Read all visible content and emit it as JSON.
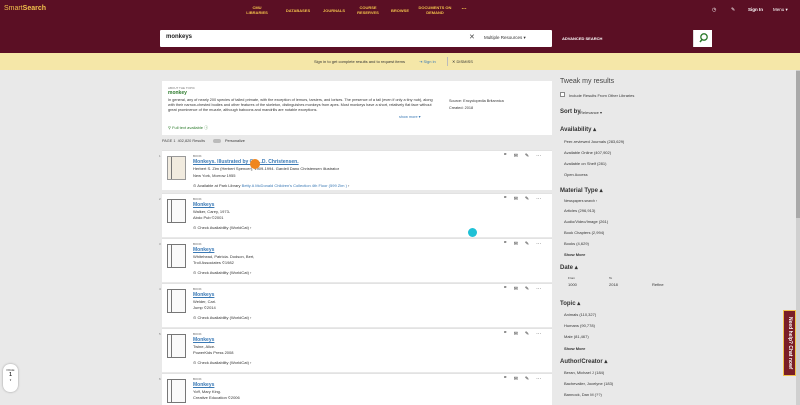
{
  "header": {
    "logo_prefix": "Smart",
    "logo_suffix": "Search",
    "nav": [
      "CMU LIBRARIES",
      "DATABASES",
      "JOURNALS",
      "COURSE RESERVES",
      "BROWSE",
      "DOCUMENTS ON DEMAND",
      "..."
    ],
    "sign_in": "Sign In",
    "menu": "Menu"
  },
  "search": {
    "value": "monkeys",
    "scope": "Multiple Resources",
    "advanced": "ADVANCED SEARCH"
  },
  "signin_banner": {
    "text": "Sign in to get complete results and to request items",
    "link": "Sign in",
    "dismiss": "DISMISS"
  },
  "topic": {
    "label": "ABOUT THE TOPIC",
    "name": "monkey",
    "text": "In general, any of nearly 200 species of tailed primate, with the exception of lemurs, tarsiers, and lorises. The presence of a tail (even if only a tiny nub), along with their narrow-chested bodies and other features of the skeleton, distinguishes monkeys from apes. Most monkeys have a short, relatively flat face without great prominence of the muzzle, although baboons and mandrills are notable exceptions.",
    "more": "show more",
    "source_label": "Source:",
    "source": "Encyclopedia Britannica",
    "created_label": "Created:",
    "created": "2018",
    "fulltext": "Full text available"
  },
  "results_meta": {
    "page_label": "PAGE 1",
    "count": "402,820 Results",
    "personalize": "Personalize"
  },
  "results": [
    {
      "type": "BOOK",
      "title": "Monkeys. Illustrated by G...",
      "title2": "...D. Christensen.",
      "line1": "Herbert S. Zim (Herbert Spencer), 1909-1994. Gardell Dano Christensen illustrator",
      "line2": "New York, Morrow 1955",
      "avail": "Available at Park Library",
      "avail_detail": "Betty A McDonald Children's Collection 4th Floor (599 Zim )",
      "num": "1"
    },
    {
      "type": "BOOK",
      "title": "Monkeys",
      "line1": "Walker, Carey, 1973-",
      "line2": "Abdo Pub ©2001",
      "avail": "Check Availability (WorldCat)",
      "num": "2"
    },
    {
      "type": "BOOK",
      "title": "Monkeys",
      "line1": "Whitehead, Patricia. Dodson, Bert,",
      "line2": "Troll Associates ©1982",
      "avail": "Check Availability (WorldCat)",
      "num": "3"
    },
    {
      "type": "BOOK",
      "title": "Monkeys",
      "line1": "Welder, Cari.",
      "line2": "Jump ©2014",
      "avail": "Check Availability (WorldCat)",
      "num": "4"
    },
    {
      "type": "BOOK",
      "title": "Monkeys",
      "line1": "Twine, Alice.",
      "line2": "PowerKids Press 2008",
      "avail": "Check Availability (WorldCat)",
      "num": "5"
    },
    {
      "type": "BOOK",
      "title": "Monkeys",
      "line1": "Yoff, Mary King.",
      "line2": "Creative Education ©2006",
      "avail": "",
      "num": "6"
    }
  ],
  "sidebar": {
    "title": "Tweak my results",
    "include_label": "Include Results From Other Libraries",
    "sort_label": "Sort by",
    "sort_value": "Relevance",
    "availability_title": "Availability",
    "availability": [
      "Peer-reviewed Journals (283,629)",
      "Available Online (407,902)",
      "Available on Shelf (281)",
      "Open Access"
    ],
    "material_title": "Material Type",
    "material_sub": "Newspapers search",
    "material": [
      "Articles (296,913)",
      "Audio/Video/Image (261)",
      "Book Chapters (2,994)",
      "Books (4,629)"
    ],
    "show_more": "Show More",
    "date_title": "Date",
    "date_from_label": "From",
    "date_to_label": "To",
    "date_from": "1000",
    "date_to": "2018",
    "refine": "Refine",
    "topic_title": "Topic",
    "topics": [
      "Animals (110,327)",
      "Humans (90,778)",
      "Male (81,467)"
    ],
    "author_title": "Author/Creator",
    "authors": [
      "Beran, Michael J (184)",
      "Bachevalier, Jocelyne (183)",
      "Bannock, Dan M (??)"
    ]
  },
  "chat": "Need help? Chat now!",
  "page_indicator": {
    "label": "PAGE",
    "value": "1"
  },
  "colors": {
    "maroon": "#5b0f24",
    "gold": "#f3c24c",
    "banner": "#f5e7a8",
    "link": "#3a79b5"
  }
}
